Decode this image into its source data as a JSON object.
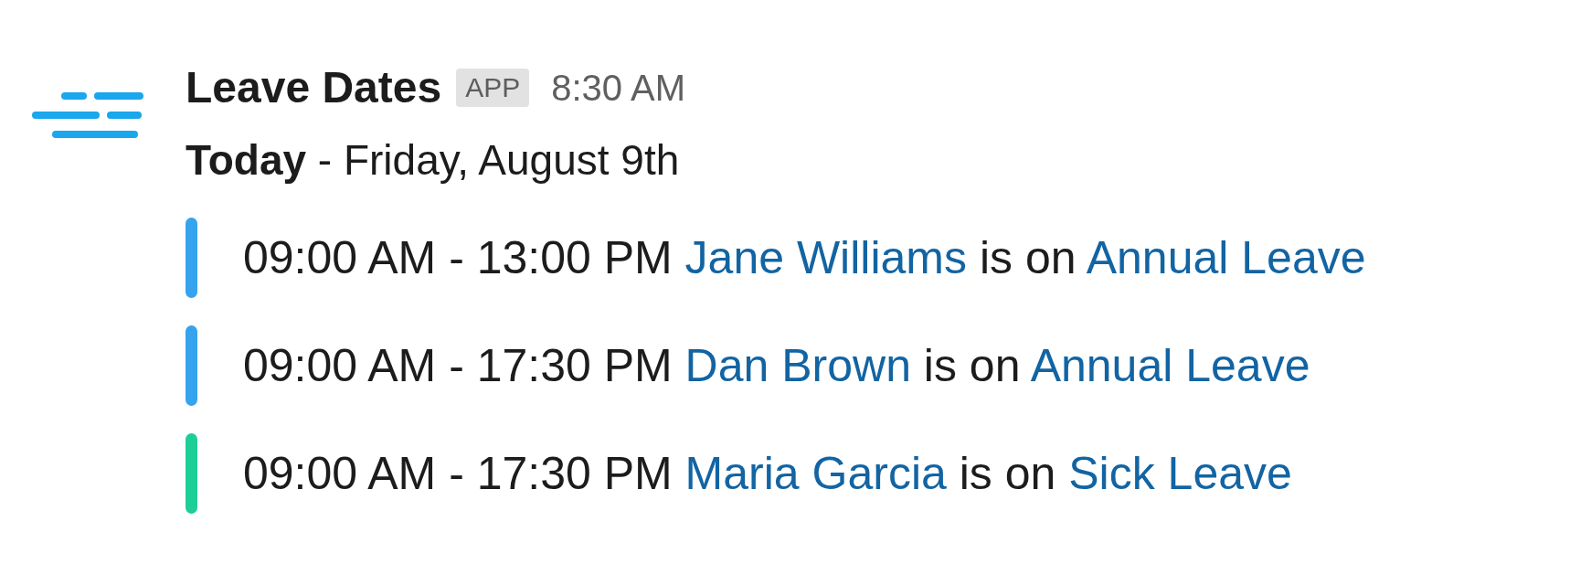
{
  "message": {
    "app_name": "Leave Dates",
    "badge": "APP",
    "time": "8:30 AM"
  },
  "date_line": "**Today** - Friday, August 9th",
  "entries": [
    {
      "time": "09:00 AM - 13:00 PM",
      "person": "Jane Williams",
      "connector": "is on",
      "leave_type": "Annual Leave",
      "color": "#36a3ee"
    },
    {
      "time": "09:00 AM - 17:30 PM",
      "person": "Dan Brown",
      "connector": "is on",
      "leave_type": "Annual Leave",
      "color": "#36a3ee"
    },
    {
      "time": "09:00 AM - 17:30 PM",
      "person": "Maria Garcia",
      "connector": "is on",
      "leave_type": "Sick Leave",
      "color": "#1dcf97"
    }
  ]
}
